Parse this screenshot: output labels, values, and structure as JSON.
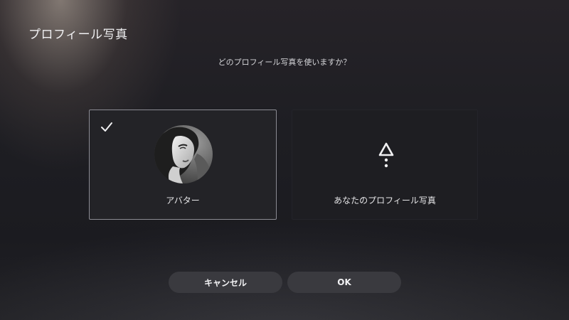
{
  "header": {
    "title": "プロフィール写真"
  },
  "prompt": {
    "question": "どのプロフィール写真を使いますか？"
  },
  "options": [
    {
      "label": "アバター",
      "selected": true,
      "icon": "avatar-portrait"
    },
    {
      "label": "あなたのプロフィール写真",
      "selected": false,
      "icon": "triangle-dots-icon"
    }
  ],
  "buttons": {
    "cancel": "キャンセル",
    "ok": "OK"
  },
  "colors": {
    "selected_border": "#8b8b93",
    "button_bg": "#3a3a3f",
    "text": "#e8e8ea"
  }
}
